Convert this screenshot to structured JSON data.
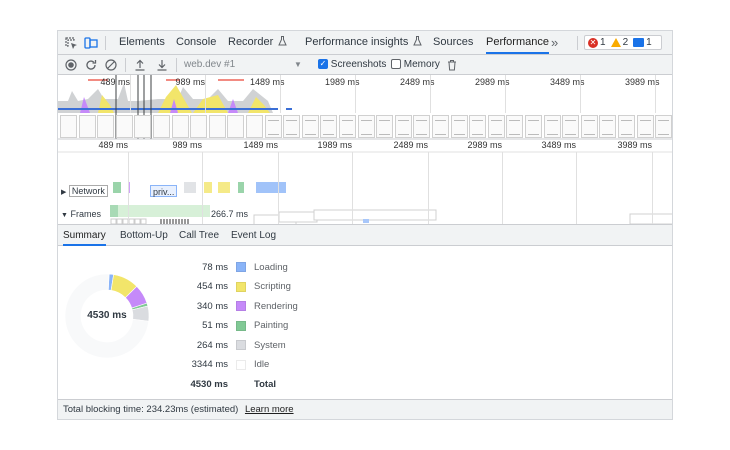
{
  "tabs": {
    "elements": "Elements",
    "console": "Console",
    "recorder": "Recorder",
    "perf_insights": "Performance insights",
    "sources": "Sources",
    "performance": "Performance",
    "more": "»",
    "errors_count": "1",
    "warnings_count": "2",
    "messages_count": "1"
  },
  "toolbar": {
    "profile_select": "web.dev #1",
    "screenshots_label": "Screenshots",
    "memory_label": "Memory",
    "screenshots_checked": true,
    "memory_checked": false
  },
  "overview_ticks": [
    "489 ms",
    "989 ms",
    "1489 ms",
    "1989 ms",
    "2489 ms",
    "2989 ms",
    "3489 ms",
    "3989 ms"
  ],
  "main_ticks": [
    "489 ms",
    "989 ms",
    "1489 ms",
    "1989 ms",
    "2489 ms",
    "2989 ms",
    "3489 ms",
    "3989 ms"
  ],
  "tracks": {
    "network_label": "Network",
    "network_item_label": "priv...",
    "frames_label": "Frames",
    "frame_time": "266.7 ms"
  },
  "panel_tabs": {
    "summary": "Summary",
    "bottom_up": "Bottom-Up",
    "call_tree": "Call Tree",
    "event_log": "Event Log"
  },
  "summary": {
    "total_label": "4530 ms",
    "rows": [
      {
        "value": "78 ms",
        "label": "Loading",
        "color": "#8ab4f8"
      },
      {
        "value": "454 ms",
        "label": "Scripting",
        "color": "#f2e56a"
      },
      {
        "value": "340 ms",
        "label": "Rendering",
        "color": "#c58af9"
      },
      {
        "value": "51 ms",
        "label": "Painting",
        "color": "#81c995"
      },
      {
        "value": "264 ms",
        "label": "System",
        "color": "#dadce0"
      },
      {
        "value": "3344 ms",
        "label": "Idle",
        "color": "#ffffff"
      },
      {
        "value": "4530 ms",
        "label": "Total",
        "color": ""
      }
    ]
  },
  "footer": {
    "text": "Total blocking time: 234.23ms (estimated)",
    "link": "Learn more"
  },
  "colors": {
    "accent": "#1a73e8",
    "loading": "#8ab4f8",
    "scripting": "#f2e56a",
    "rendering": "#c58af9",
    "painting": "#81c995",
    "system": "#dadce0",
    "idle": "#ffffff"
  }
}
